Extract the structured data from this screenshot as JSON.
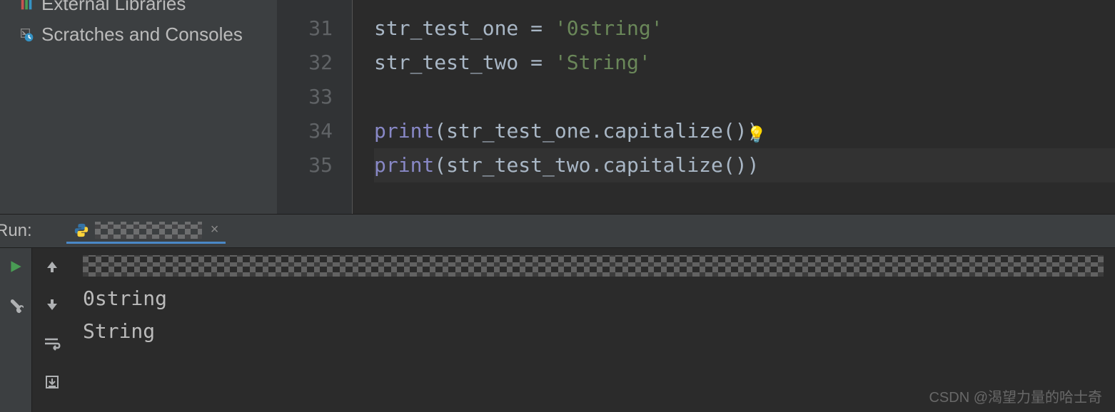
{
  "sidebar": {
    "items": [
      {
        "label": "External Libraries",
        "icon": "library"
      },
      {
        "label": "Scratches and Consoles",
        "icon": "scratch"
      }
    ]
  },
  "editor": {
    "lines": [
      {
        "num": "31",
        "tokens": [
          {
            "t": "id",
            "v": "str_test_one"
          },
          {
            "t": "op",
            "v": " = "
          },
          {
            "t": "str",
            "v": "'0string'"
          }
        ]
      },
      {
        "num": "32",
        "tokens": [
          {
            "t": "id",
            "v": "str_test_two"
          },
          {
            "t": "op",
            "v": " = "
          },
          {
            "t": "str",
            "v": "'String'"
          }
        ]
      },
      {
        "num": "33",
        "tokens": []
      },
      {
        "num": "34",
        "tokens": [
          {
            "t": "builtin",
            "v": "print"
          },
          {
            "t": "op",
            "v": "("
          },
          {
            "t": "id",
            "v": "str_test_one"
          },
          {
            "t": "op",
            "v": "."
          },
          {
            "t": "fn",
            "v": "capitalize"
          },
          {
            "t": "op",
            "v": "())"
          }
        ],
        "bulb": true
      },
      {
        "num": "35",
        "tokens": [
          {
            "t": "builtin",
            "v": "print"
          },
          {
            "t": "op",
            "v": "("
          },
          {
            "t": "id",
            "v": "str_test_two"
          },
          {
            "t": "op",
            "v": "."
          },
          {
            "t": "fn",
            "v": "capitalize"
          },
          {
            "t": "op",
            "v": "())"
          }
        ],
        "hl": true
      }
    ]
  },
  "run": {
    "label": "Run:",
    "output": [
      "0string",
      "String"
    ]
  },
  "watermark": "CSDN @渴望力量的哈士奇"
}
